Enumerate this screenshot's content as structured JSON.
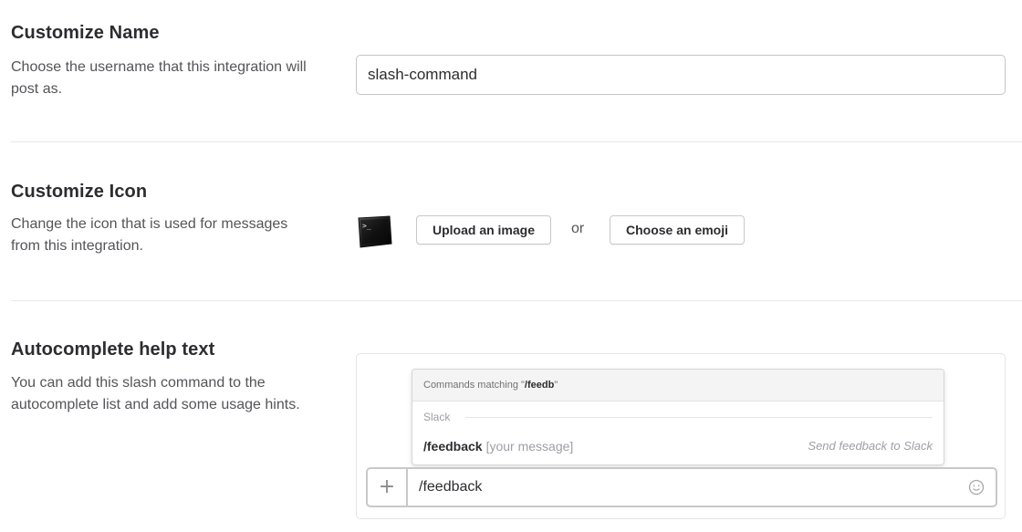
{
  "customize_name": {
    "title": "Customize Name",
    "description": "Choose the username that this integration will post as.",
    "input_value": "slash-command"
  },
  "customize_icon": {
    "title": "Customize Icon",
    "description": "Change the icon that is used for messages from this integration.",
    "icon": "terminal-icon",
    "upload_label": "Upload an image",
    "or_label": "or",
    "emoji_label": "Choose an emoji"
  },
  "autocomplete": {
    "title": "Autocomplete help text",
    "description": "You can add this slash command to the autocomplete list and add some usage hints.",
    "popup": {
      "header_prefix": "Commands matching \"",
      "header_query": "/feedb",
      "header_suffix": "\"",
      "group_label": "Slack",
      "command": "/feedback",
      "usage_hint": "[your message]",
      "command_description": "Send feedback to Slack"
    },
    "message_input": {
      "plus_label": "+",
      "value": "/feedback",
      "emoji_icon": "smiley-icon"
    }
  },
  "colors": {
    "text": "#2c2d30",
    "muted": "#555459",
    "border": "#c8c8c8",
    "divider": "#e8e8e8"
  }
}
